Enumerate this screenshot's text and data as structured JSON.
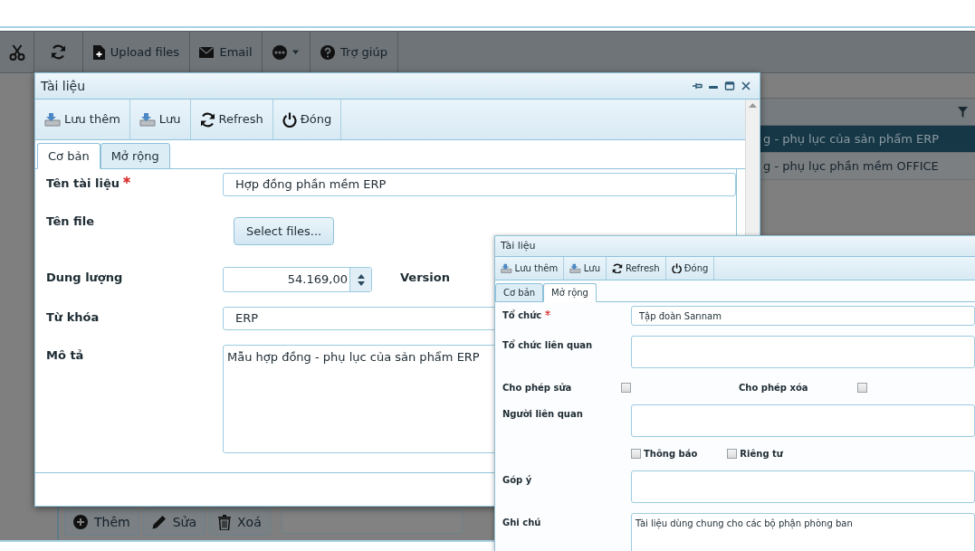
{
  "app_toolbar": [
    {
      "kind": "cut"
    },
    {
      "kind": "refresh"
    },
    {
      "kind": "upload",
      "label": "Upload files"
    },
    {
      "kind": "email",
      "label": "Email"
    },
    {
      "kind": "more"
    },
    {
      "kind": "help",
      "label": "Trợ giúp"
    }
  ],
  "grid": {
    "rows": [
      {
        "text": "g - phụ lục của sản phẩm ERP",
        "selected": true
      },
      {
        "text": "g - phụ lục phần mềm OFFICE",
        "selected": false
      }
    ]
  },
  "bottom_bar": {
    "buttons": [
      {
        "kind": "add",
        "label": "Thêm"
      },
      {
        "kind": "edit",
        "label": "Sửa"
      },
      {
        "kind": "delete",
        "label": "Xoá"
      }
    ]
  },
  "dialog": {
    "title": "Tài liệu",
    "toolbar": [
      {
        "kind": "savenew",
        "label": "Lưu thêm"
      },
      {
        "kind": "save",
        "label": "Lưu"
      },
      {
        "kind": "refresh",
        "label": "Refresh"
      },
      {
        "kind": "close",
        "label": "Đóng"
      }
    ],
    "tabs": [
      {
        "label": "Cơ bản",
        "selected": true
      },
      {
        "label": "Mở rộng",
        "selected": false
      }
    ],
    "fields": [
      {
        "kind": "text",
        "label": "Tên tài liệu",
        "required": true,
        "value": "Hợp đồng phần mềm ERP"
      },
      {
        "kind": "file",
        "label": "Tên file",
        "required": false,
        "button": "Select files..."
      },
      {
        "kind": "number",
        "label": "Dung lượng",
        "required": false,
        "value": "54.169,00",
        "side_label": "Version"
      },
      {
        "kind": "text",
        "label": "Từ khóa",
        "required": false,
        "value": "ERP"
      },
      {
        "kind": "textarea",
        "label": "Mô tả",
        "required": false,
        "value": "Mẫu hợp đồng - phụ lục của sản phẩm ERP"
      }
    ]
  },
  "dialog_2": {
    "title": "Tài liệu",
    "toolbar": [
      {
        "kind": "savenew",
        "label": "Lưu thêm"
      },
      {
        "kind": "save",
        "label": "Lưu"
      },
      {
        "kind": "refresh",
        "label": "Refresh"
      },
      {
        "kind": "close",
        "label": "Đóng"
      }
    ],
    "tabs": [
      {
        "label": "Cơ bản",
        "selected": false
      },
      {
        "label": "Mở rộng",
        "selected": true
      }
    ],
    "fields": [
      {
        "kind": "text",
        "label": "Tổ chức",
        "required": true,
        "value": "Tập đoàn Sannam"
      },
      {
        "kind": "textarea",
        "label": "Tổ chức liên quan",
        "required": false
      },
      {
        "kind": "checks",
        "items": [
          {
            "label": "Cho phép sửa",
            "checked": false
          },
          {
            "label": "Cho phép xóa",
            "checked": false
          }
        ]
      },
      {
        "kind": "textarea",
        "label": "Người liên quan",
        "required": false
      },
      {
        "kind": "options",
        "items": [
          {
            "label": "Thông báo",
            "checked": false
          },
          {
            "label": "Riêng tư",
            "checked": false
          }
        ]
      },
      {
        "kind": "textarea",
        "label": "Góp ý",
        "required": false
      },
      {
        "kind": "textarea",
        "label": "Ghi chú",
        "required": false,
        "value": "Tài liệu dùng chung cho các bộ phận phòng ban"
      }
    ]
  }
}
